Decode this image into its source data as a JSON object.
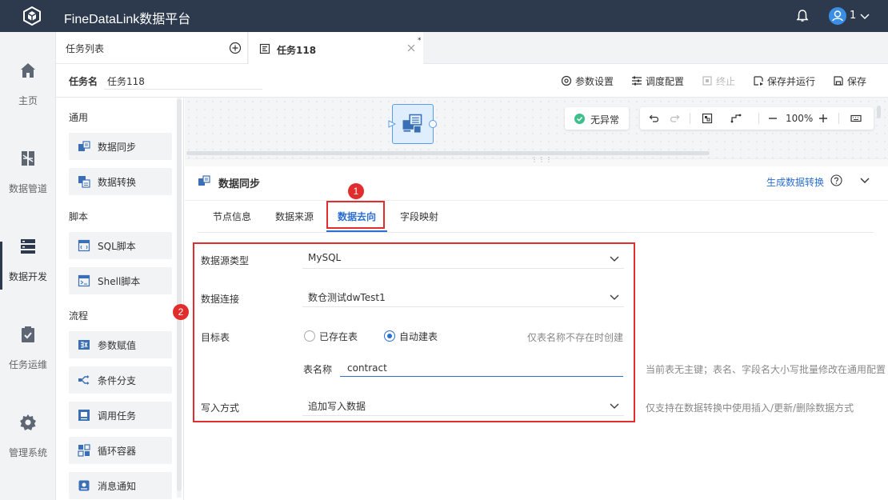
{
  "app": {
    "title": "FineDataLink数据平台",
    "user": "1"
  },
  "nav": {
    "items": [
      {
        "label": "主页",
        "icon": "home-icon"
      },
      {
        "label": "数据管道",
        "icon": "pipeline-icon"
      },
      {
        "label": "数据开发",
        "icon": "develop-icon",
        "active": true
      },
      {
        "label": "任务运维",
        "icon": "ops-clipboard-icon"
      },
      {
        "label": "管理系统",
        "icon": "gear-icon"
      }
    ]
  },
  "tasklist": {
    "label": "任务列表"
  },
  "tab": {
    "label": "任务118",
    "modified": "*"
  },
  "taskname": {
    "label": "任务名",
    "value": "任务118"
  },
  "toolbar": {
    "params": "参数设置",
    "schedule": "调度配置",
    "stop": "终止",
    "save_run": "保存并运行",
    "save": "保存"
  },
  "nodelist": {
    "sections": {
      "general": "通用",
      "script": "脚本",
      "flow": "流程"
    },
    "general": [
      "数据同步",
      "数据转换"
    ],
    "script": [
      "SQL脚本",
      "Shell脚本"
    ],
    "flow": [
      "参数赋值",
      "条件分支",
      "调用任务",
      "循环容器",
      "消息通知"
    ]
  },
  "canvas": {
    "status": "无异常",
    "zoom": "100%"
  },
  "detail": {
    "title": "数据同步",
    "gen_link": "生成数据转换",
    "tabs": [
      "节点信息",
      "数据来源",
      "数据去向",
      "字段映射"
    ],
    "active_tab": 2,
    "callouts": [
      "1",
      "2"
    ]
  },
  "form": {
    "source_type_label": "数据源类型",
    "source_type_value": "MySQL",
    "connection_label": "数据连接",
    "connection_value": "数仓测试dwTest1",
    "target_label": "目标表",
    "radio_existing": "已存在表",
    "radio_auto": "自动建表",
    "target_hint": "仅表名称不存在时创建",
    "table_name_label": "表名称",
    "table_name_value": "contract",
    "table_hint": "当前表无主键；表名、字段名大小写批量修改在通用配置",
    "write_label": "写入方式",
    "write_value": "追加写入数据",
    "write_hint": "仅支持在数据转换中使用插入/更新/删除数据方式"
  },
  "colors": {
    "topbar": "#2d3a4e",
    "accent": "#2b6fd1",
    "callout": "#e02d2d"
  }
}
